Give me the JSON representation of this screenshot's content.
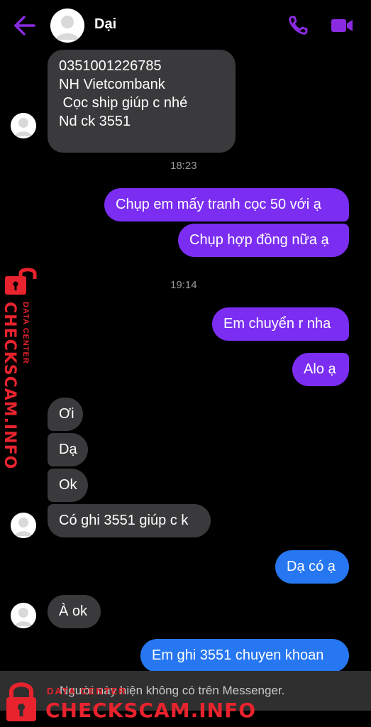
{
  "header": {
    "contact_name": "Dại"
  },
  "first_message": {
    "lines": [
      "0351001226785",
      "NH Vietcombank",
      " Cọc ship giúp c nhé",
      "Nd ck 3551"
    ]
  },
  "timestamps": [
    "18:23",
    "19:14"
  ],
  "messages": {
    "m1": "Chụp em mấy tranh cọc 50 với ạ",
    "m2": "Chụp hợp đồng nữa ạ",
    "m3": "Em chuyển r nha",
    "m4": "Alo ạ",
    "m5": "Ơi",
    "m6": "Dạ",
    "m7": "Ok",
    "m8": "Có ghi 3551 giúp c k",
    "m9": "Dạ có ạ",
    "m10": "À ok",
    "m11": "Em ghi 3551 chuyen khoan"
  },
  "bottom_notice": "Người này hiện không có trên Messenger.",
  "watermark": {
    "brand": "CHECKSCAM.INFO",
    "sub": "DATA CENTER"
  },
  "colors": {
    "accent": "#8a2be2",
    "outgoing_purple": "#7b2ef2",
    "outgoing_blue": "#2677f1",
    "incoming": "#3a3a3c",
    "watermark_red": "#e8232d"
  },
  "icons": [
    "back-arrow-icon",
    "phone-icon",
    "video-camera-icon",
    "lock-icon"
  ]
}
